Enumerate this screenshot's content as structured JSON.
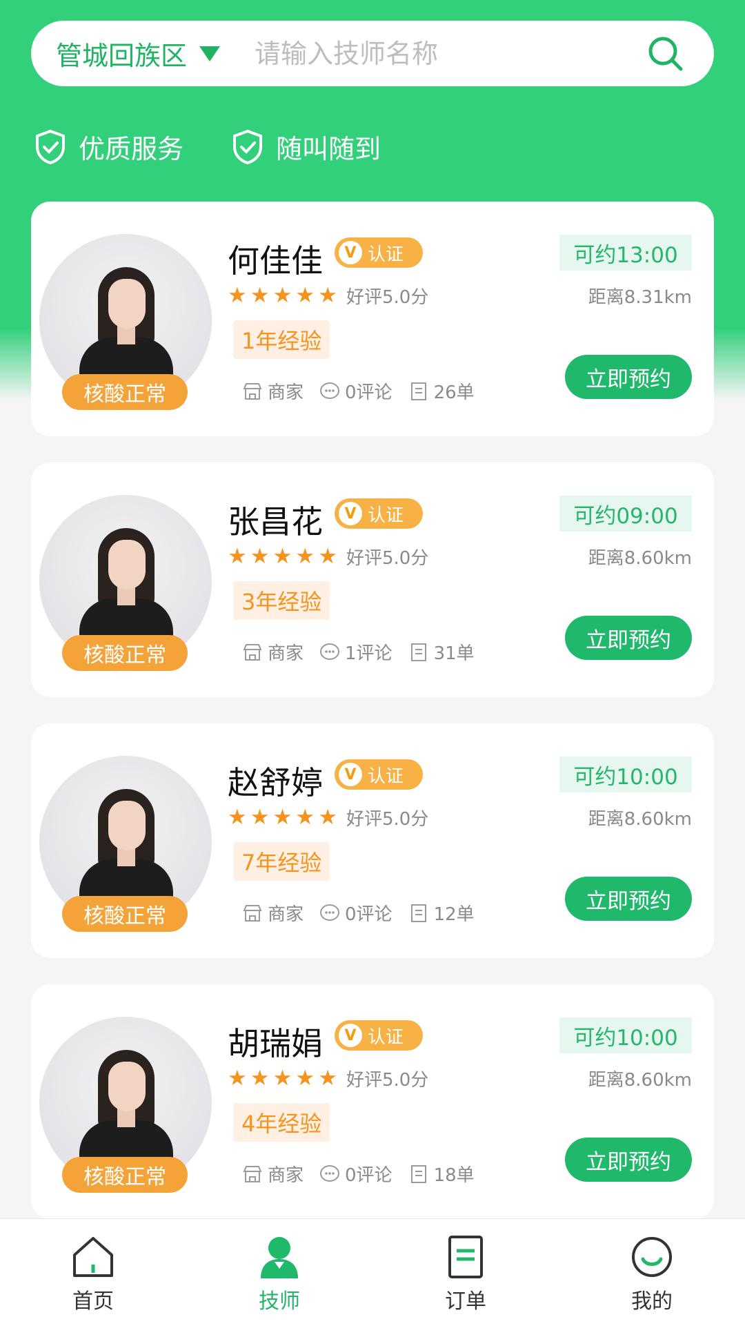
{
  "search": {
    "city": "管城回族区",
    "placeholder": "请输入技师名称",
    "icon": "search-icon"
  },
  "features": [
    {
      "label": "优质服务",
      "icon": "shield-check-icon"
    },
    {
      "label": "随叫随到",
      "icon": "shield-check-icon"
    }
  ],
  "cert_label": "认证",
  "cert_mark": "V",
  "nucleic_label": "核酸正常",
  "book_label": "立即预约",
  "merchant_label": "商家",
  "colors": {
    "primary": "#33d07c",
    "accent": "#f5931f",
    "button": "#20b86b"
  },
  "technicians": [
    {
      "name": "何佳佳",
      "rating": "好评5.0分",
      "stars": 5,
      "experience": "1年经验",
      "available": "可约13:00",
      "distance": "距离8.31km",
      "comments": "0评论",
      "orders": "26单"
    },
    {
      "name": "张昌花",
      "rating": "好评5.0分",
      "stars": 5,
      "experience": "3年经验",
      "available": "可约09:00",
      "distance": "距离8.60km",
      "comments": "1评论",
      "orders": "31单"
    },
    {
      "name": "赵舒婷",
      "rating": "好评5.0分",
      "stars": 5,
      "experience": "7年经验",
      "available": "可约10:00",
      "distance": "距离8.60km",
      "comments": "0评论",
      "orders": "12单"
    },
    {
      "name": "胡瑞娟",
      "rating": "好评5.0分",
      "stars": 5,
      "experience": "4年经验",
      "available": "可约10:00",
      "distance": "距离8.60km",
      "comments": "0评论",
      "orders": "18单"
    }
  ],
  "tabs": [
    {
      "label": "首页",
      "icon": "home-icon",
      "active": false
    },
    {
      "label": "技师",
      "icon": "technician-icon",
      "active": true
    },
    {
      "label": "订单",
      "icon": "order-icon",
      "active": false
    },
    {
      "label": "我的",
      "icon": "profile-icon",
      "active": false
    }
  ]
}
